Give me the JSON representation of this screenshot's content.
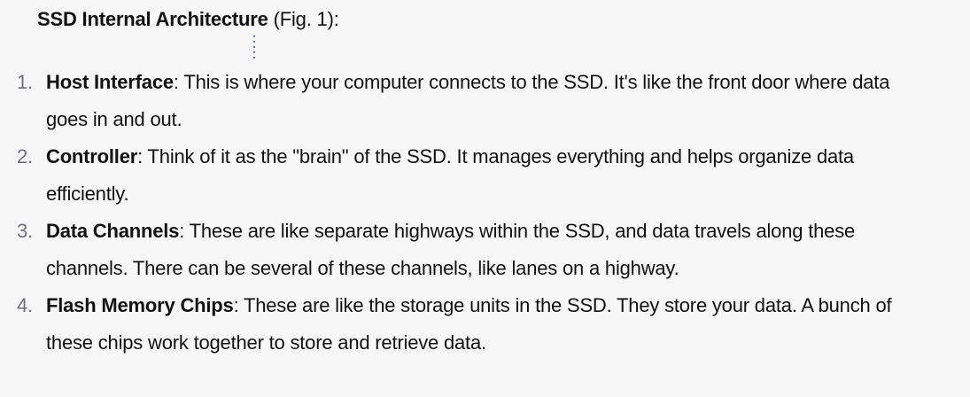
{
  "heading": {
    "bold": "SSD Internal Architecture",
    "rest": " (Fig. 1):"
  },
  "items": [
    {
      "num": "1.",
      "term": "Host Interface",
      "text": ": This is where your computer connects to the SSD. It's like the front door where data goes in and out."
    },
    {
      "num": "2.",
      "term": "Controller",
      "text": ": Think of it as the \"brain\" of the SSD. It manages everything and helps organize data efficiently."
    },
    {
      "num": "3.",
      "term": "Data Channels",
      "text": ": These are like separate highways within the SSD, and data travels along these channels. There can be several of these channels, like lanes on a highway."
    },
    {
      "num": "4.",
      "term": "Flash Memory Chips",
      "text": ": These are like the storage units in the SSD. They store your data. A bunch of these chips work together to store and retrieve data."
    }
  ]
}
